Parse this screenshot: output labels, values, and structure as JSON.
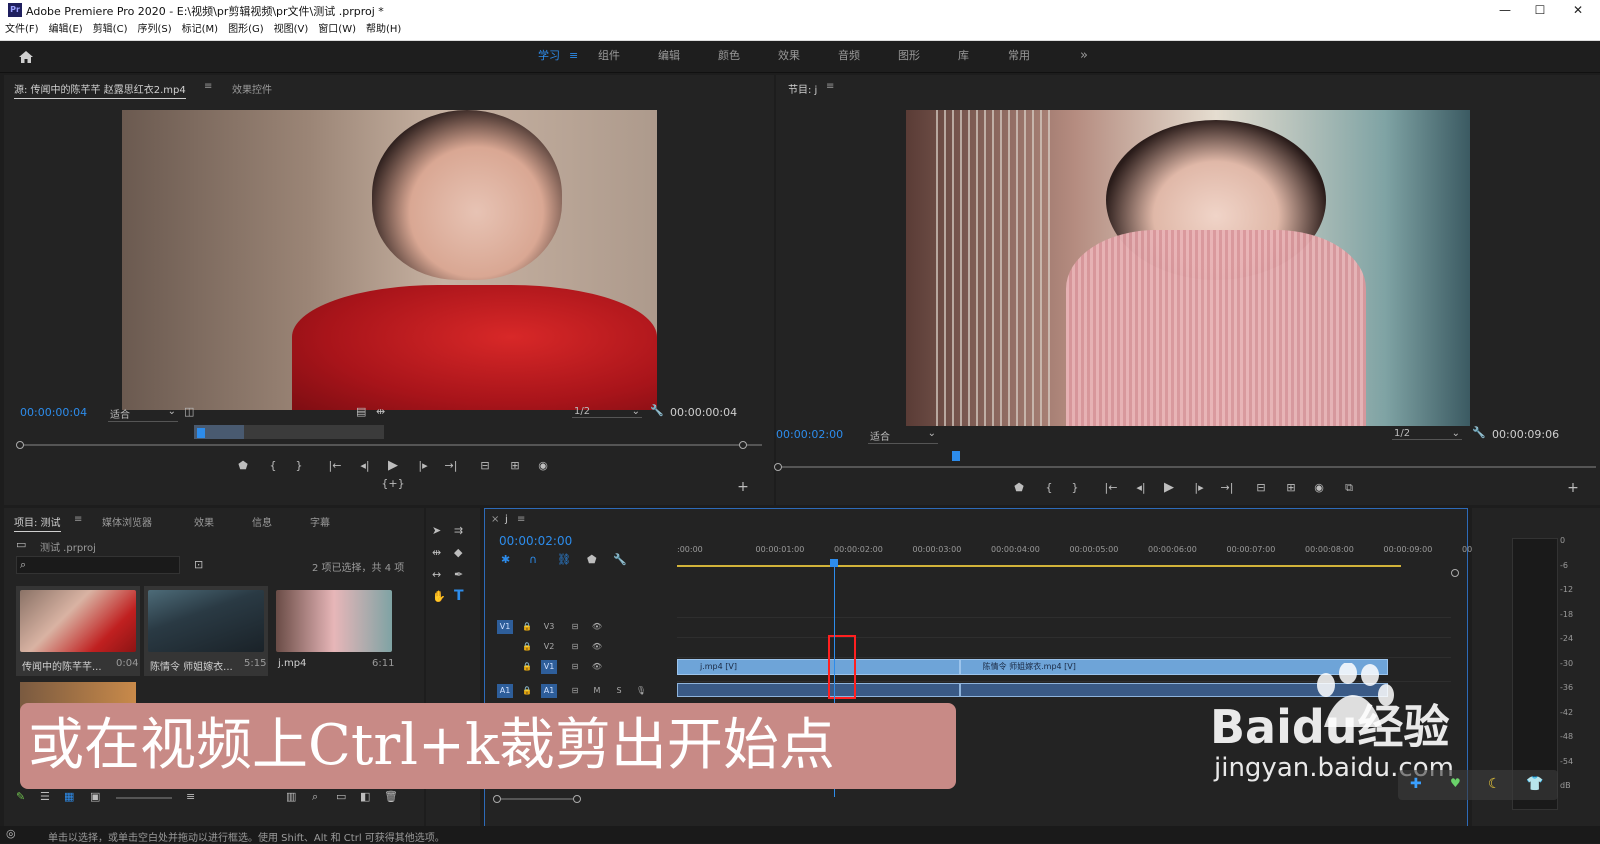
{
  "titlebar": {
    "logo": "Pr",
    "title": "Adobe Premiere Pro 2020 - E:\\视频\\pr剪辑视频\\pr文件\\测试 .prproj *",
    "minimize": "—",
    "maximize": "☐",
    "close": "✕"
  },
  "menu": [
    "文件(F)",
    "编辑(E)",
    "剪辑(C)",
    "序列(S)",
    "标记(M)",
    "图形(G)",
    "视图(V)",
    "窗口(W)",
    "帮助(H)"
  ],
  "workspaces": {
    "home_icon": "home-icon",
    "items": [
      "学习",
      "组件",
      "编辑",
      "颜色",
      "效果",
      "音频",
      "图形",
      "库",
      "常用"
    ],
    "active": "学习",
    "more": "»",
    "menu_glyph": "≡"
  },
  "source": {
    "tab_label": "源: 传闻中的陈芊芊 赵露思红衣2.mp4",
    "tab_menu": "≡",
    "tab2": "效果控件",
    "timecode": "00:00:00:04",
    "fit": "适合",
    "resolution": "1/2",
    "duration": "00:00:00:04",
    "playhead": 0.24
  },
  "program": {
    "tab_label": "节目: j",
    "tab_menu": "≡",
    "timecode": "00:00:02:00",
    "fit": "适合",
    "resolution": "1/2",
    "duration": "00:00:09:06",
    "playhead": 0.215
  },
  "transport": {
    "marker": "⬟",
    "in": "{",
    "out": "}",
    "go_in": "|←",
    "step_back": "◂|",
    "play": "▶",
    "step_fwd": "|▸",
    "go_out": "→|",
    "insert": "⊟",
    "overwrite": "⊞",
    "export": "◉",
    "compare": "⧉",
    "trim": "{+}",
    "add": "+"
  },
  "project": {
    "tabs": [
      "项目: 测试",
      "媒体浏览器",
      "效果",
      "信息",
      "字幕"
    ],
    "tab_menu": "≡",
    "file": "测试 .prproj",
    "search_placeholder": "",
    "selection_info": "2 项已选择，共 4 项",
    "items": [
      {
        "name": "传闻中的陈芊芊...",
        "duration": "0:04"
      },
      {
        "name": "陈情令 师姐嫁衣...",
        "duration": "5:15"
      },
      {
        "name": "j.mp4",
        "duration": "6:11"
      }
    ]
  },
  "timeline": {
    "tab_close": "×",
    "tab_label": "j",
    "tab_menu": "≡",
    "timecode": "00:00:02:00",
    "ticks": [
      ":00:00",
      "00:00:01:00",
      "00:00:02:00",
      "00:00:03:00",
      "00:00:04:00",
      "00:00:05:00",
      "00:00:06:00",
      "00:00:07:00",
      "00:00:08:00",
      "00:00:09:00",
      "00"
    ],
    "playhead_seconds": 2.0,
    "tracks": [
      {
        "src": "V1",
        "lock": "🔒",
        "id": "V3",
        "fx": "⊟",
        "eye": "👁"
      },
      {
        "src": "",
        "lock": "🔒",
        "id": "V2",
        "fx": "⊟",
        "eye": "👁"
      },
      {
        "src": "",
        "lock": "🔒",
        "id": "V1",
        "fx": "⊟",
        "eye": "👁"
      },
      {
        "src": "A1",
        "lock": "🔒",
        "id": "A1",
        "fx": "⊟",
        "m": "M",
        "s": "S",
        "mic": "🎙"
      }
    ],
    "clips": [
      {
        "label": "j.mp4 [V]",
        "start": 0.0,
        "end": 3.6
      },
      {
        "label": "陈情令 师姐嫁衣.mp4 [V]",
        "start": 3.6,
        "end": 9.06
      }
    ]
  },
  "meter": {
    "scale": [
      "0",
      "-6",
      "-12",
      "-18",
      "-24",
      "-30",
      "-36",
      "-42",
      "-48",
      "-54",
      "dB"
    ]
  },
  "overlay": {
    "caption": "或在视频上Ctrl+k裁剪出开始点"
  },
  "watermark": {
    "brand": "Baidu经验",
    "url": "jingyan.baidu.com"
  },
  "status": {
    "text": "单击以选择，或单击空白处并拖动以进行框选。使用 Shift、Alt 和 Ctrl 可获得其他选项。"
  },
  "colors": {
    "accent": "#2d8ceb",
    "clip": "#6ea4d8",
    "caption_bg": "#c88a86",
    "highlight_box": "#ff2020"
  }
}
